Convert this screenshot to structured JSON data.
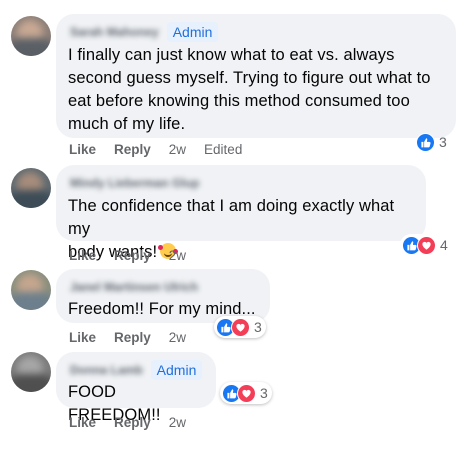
{
  "comments": [
    {
      "author": "Sarah Mahoney",
      "badge": "Admin",
      "text": "I finally can just know what to eat vs. always\nsecond guess myself. Trying to figure out what to\neat before knowing this method consumed too\nmuch of my life.",
      "like_label": "Like",
      "reply_label": "Reply",
      "time": "2w",
      "edited": "Edited",
      "reactions": [
        "like"
      ],
      "reaction_count": "3"
    },
    {
      "author": "Mindy Lieberman Glup",
      "text": "The confidence that I am doing exactly what my\nbody wants!",
      "emoji": "smiling-face-with-hearts",
      "like_label": "Like",
      "reply_label": "Reply",
      "time": "2w",
      "reactions": [
        "like",
        "love"
      ],
      "reaction_count": "4"
    },
    {
      "author": "Janel Martinsen Ulrich",
      "text": "Freedom!! For my mind...",
      "like_label": "Like",
      "reply_label": "Reply",
      "time": "2w",
      "reactions": [
        "like",
        "love"
      ],
      "reaction_count": "3"
    },
    {
      "author": "Donna Lamb",
      "badge": "Admin",
      "text": "FOOD FREEDOM!!",
      "like_label": "Like",
      "reply_label": "Reply",
      "time": "2w",
      "reactions": [
        "like",
        "love"
      ],
      "reaction_count": "3"
    }
  ],
  "colors": {
    "bubble": "#f0f2f5",
    "like_blue": "#1877f2",
    "love_red": "#f33e58",
    "admin_text": "#216fdb",
    "meta_gray": "#65676b"
  }
}
